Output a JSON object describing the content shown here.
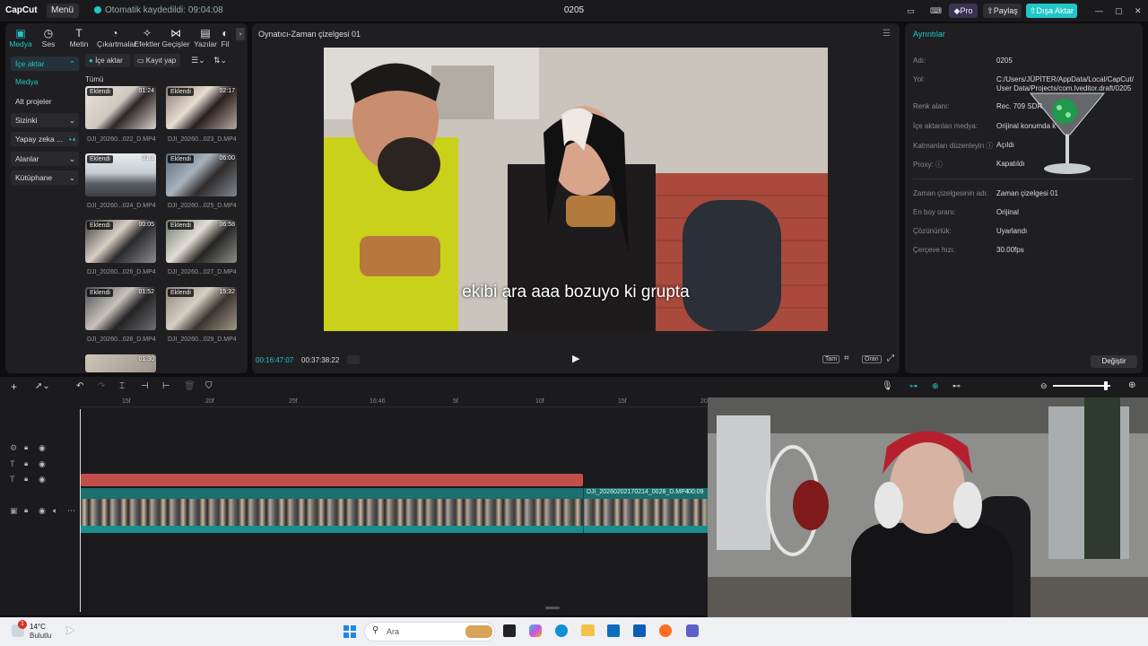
{
  "titlebar": {
    "logo": "CapCut",
    "menu": "Menü",
    "autosave": "Otomatik kaydedildi: 09:04:08",
    "project": "0205",
    "pro": "Pro",
    "share": "Paylaş",
    "export": "Dışa Aktar"
  },
  "tools": [
    {
      "label": "Medya",
      "icon": "media-icon"
    },
    {
      "label": "Ses",
      "icon": "audio-icon"
    },
    {
      "label": "Metin",
      "icon": "text-icon"
    },
    {
      "label": "Çıkartmalar",
      "icon": "sticker-icon"
    },
    {
      "label": "Efektler",
      "icon": "effects-icon"
    },
    {
      "label": "Geçişler",
      "icon": "transitions-icon"
    },
    {
      "label": "Yazılar",
      "icon": "captions-icon"
    },
    {
      "label": "Fil",
      "icon": "filter-icon"
    }
  ],
  "sidebar": [
    {
      "label": "İçe aktar"
    },
    {
      "label": "Medya"
    },
    {
      "label": "Alt projeler"
    },
    {
      "label": "Sizinki"
    },
    {
      "label": "Yapay zeka ..."
    },
    {
      "label": "Alanlar"
    },
    {
      "label": "Kütüphane"
    }
  ],
  "media": {
    "import_button": "İçe aktar",
    "record_button": "Kayıt yap",
    "all_label": "Tümü",
    "items": [
      {
        "badge": "Eklendi",
        "duration": "01:24",
        "name": "DJI_20260...022_D.MP4"
      },
      {
        "badge": "Eklendi",
        "duration": "02:17",
        "name": "DJI_20260...023_D.MP4"
      },
      {
        "badge": "Eklendi",
        "duration": "01:1",
        "name": "DJI_20260...024_D.MP4"
      },
      {
        "badge": "Eklendi",
        "duration": "06:00",
        "name": "DJI_20260...025_D.MP4"
      },
      {
        "badge": "Eklendi",
        "duration": "00:05",
        "name": "DJI_20260...026_D.MP4"
      },
      {
        "badge": "Eklendi",
        "duration": "06:58",
        "name": "DJI_20260...027_D.MP4"
      },
      {
        "badge": "Eklendi",
        "duration": "01:52",
        "name": "DJI_20260...028_D.MP4"
      },
      {
        "badge": "Eklendi",
        "duration": "15:32",
        "name": "DJI_20260...029_D.MP4"
      },
      {
        "badge": "",
        "duration": "01:30",
        "name": ""
      }
    ]
  },
  "player": {
    "title": "Oynatıcı-Zaman çizelgesi 01",
    "subtitle": "ekibi ara aaa bozuyo ki grupta",
    "current_time": "00:16:47:07",
    "total_time": "00:37:38:22",
    "full_label": "Tam",
    "ratio_label": "Oran"
  },
  "details": {
    "header": "Ayrıntılar",
    "rows": [
      {
        "label": "Adı:",
        "value": "0205"
      },
      {
        "label": "Yol:",
        "value": "C:/Users/JÜPİTER/AppData/Local/CapCut/"
      },
      {
        "label": "",
        "value": "User Data/Projects/com.lveditor.draft/0205"
      },
      {
        "label": "Renk alanı:",
        "value": "Rec. 709 SDR"
      },
      {
        "label": "İçe aktarılan medya:",
        "value": "Orijinal konumda k"
      },
      {
        "label": "Katmanları düzenleyin",
        "value": "Açıldı"
      },
      {
        "label": "Proxy:",
        "value": "Kapatıldı"
      },
      {
        "label": "Zaman çizelgesinin adı:",
        "value": "Zaman çizelgesi 01"
      },
      {
        "label": "En boy oranı:",
        "value": "Orijinal"
      },
      {
        "label": "Çözünürlük:",
        "value": "Uyarlandı"
      },
      {
        "label": "Çerçeve hızı:",
        "value": "30.00fps"
      }
    ],
    "modify_button": "Değiştir"
  },
  "timeline": {
    "ruler": [
      "15f",
      "20f",
      "25f",
      "16:46",
      "5f",
      "10f",
      "15f",
      "20"
    ],
    "clip_name": "DJI_20260202170214_0028_D.MP4",
    "clip_time": "00:09"
  },
  "taskbar": {
    "temperature": "14°C",
    "weather": "Bulutlu",
    "search_placeholder": "Ara",
    "notification_count": "1"
  },
  "colors": {
    "accent": "#21c7c7",
    "title_track": "#c24f4a",
    "video_track": "#1a8e8e"
  }
}
